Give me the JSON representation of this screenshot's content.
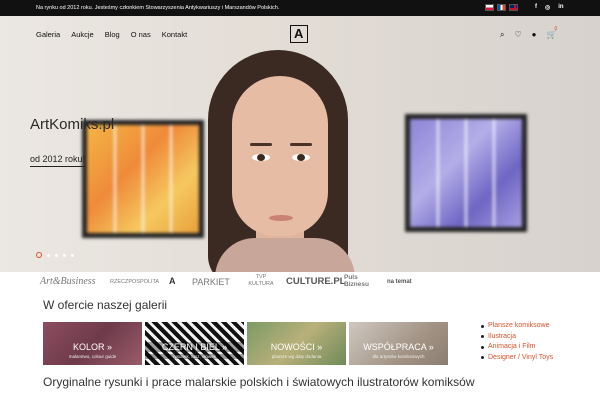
{
  "topbar": {
    "notice": "Na rynku od 2012 roku. Jesteśmy członkiem Stowarzyszenia Antykwariuszy i Marszandów Polskich.",
    "languages": [
      "pl-flag",
      "fr-flag",
      "en-flag"
    ],
    "social": [
      {
        "icon": "facebook-icon",
        "glyph": "f"
      },
      {
        "icon": "instagram-icon",
        "glyph": "◎"
      },
      {
        "icon": "linkedin-icon",
        "glyph": "in"
      }
    ]
  },
  "nav": {
    "items": [
      "Galeria",
      "Aukcje",
      "Blog",
      "O nas",
      "Kontakt"
    ],
    "logo_letter": "A",
    "icons": [
      {
        "name": "search-icon",
        "glyph": "⌕"
      },
      {
        "name": "wishlist-icon",
        "glyph": "♡"
      },
      {
        "name": "account-icon",
        "glyph": "●"
      }
    ],
    "cart_count": "0"
  },
  "hero": {
    "title": "ArtKomiks.pl",
    "subtitle": "od 2012 roku!",
    "slides_count": 5,
    "active_slide": 1
  },
  "press_logos": [
    "Art&Business",
    "RZECZPOSPOLITA",
    "A",
    "PARKIET",
    "TVP KULTURA",
    "CULTURE.PL",
    "Puls Biznesu",
    "na temat"
  ],
  "offer": {
    "title": "W ofercie naszej galerii",
    "tiles": [
      {
        "label": "KOLOR »",
        "sub": "malarstwo, colour guide"
      },
      {
        "label": "CZERŃ I BIEL »",
        "sub": "rysunek, tusz, ołówek"
      },
      {
        "label": "NOWOŚCI »",
        "sub": "plansze wg daty dodania"
      },
      {
        "label": "WSPÓŁPRACA »",
        "sub": "dla artystów komiksowych"
      }
    ],
    "categories": [
      "Plansze komiksowe",
      "Ilustracja",
      "Animacja i Film",
      "Designer / Vinyl Toys"
    ]
  },
  "bottom_title": "Oryginalne rysunki i prace malarskie polskich i światowych ilustratorów komiksów",
  "colors": {
    "accent": "#d9532c",
    "topbar": "#111111"
  }
}
